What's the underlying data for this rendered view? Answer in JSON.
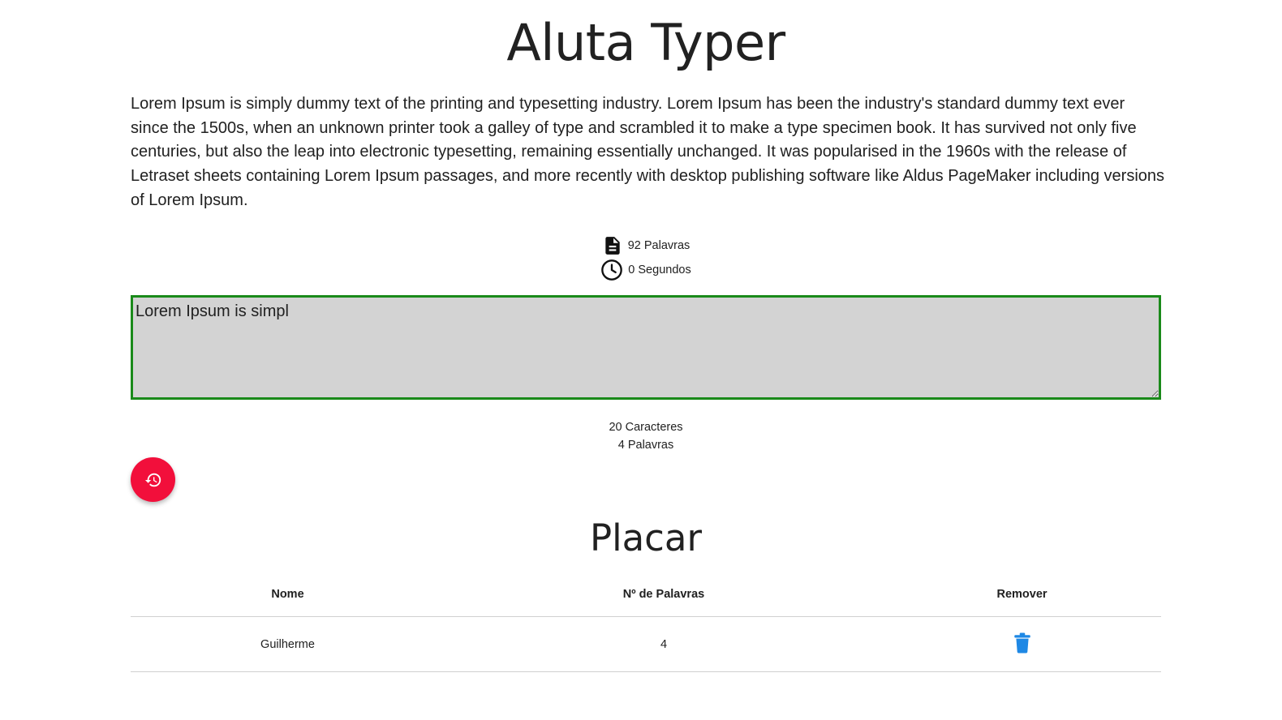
{
  "header": {
    "title": "Aluta Typer"
  },
  "phrase": {
    "text": "Lorem Ipsum is simply dummy text of the printing and typesetting industry. Lorem Ipsum has been the industry's standard dummy text ever since the 1500s, when an unknown printer took a galley of type and scrambled it to make a type specimen book. It has survived not only five centuries, but also the leap into electronic typesetting, remaining essentially unchanged. It was popularised in the 1960s with the release of Letraset sheets containing Lorem Ipsum passages, and more recently with desktop publishing software like Aldus PageMaker including versions of Lorem Ipsum."
  },
  "stats": {
    "words": "92 Palavras",
    "words_icon": "document-icon",
    "time": "0 Segundos",
    "time_icon": "clock-icon"
  },
  "typing": {
    "value": "Lorem Ipsum is simpl",
    "border_color": "#1a8a1a",
    "background": "#d3d3d3"
  },
  "counters": {
    "characters": "20 Caracteres",
    "words": "4 Palavras"
  },
  "restart_button": {
    "icon": "history-icon",
    "color": "#f20f3b"
  },
  "scoreboard": {
    "title": "Placar",
    "headers": {
      "name": "Nome",
      "words": "Nº de Palavras",
      "remove": "Remover"
    },
    "rows": [
      {
        "name": "Guilherme",
        "words": "4",
        "remove_icon": "trash-icon"
      }
    ],
    "remove_icon_color": "#1e88e5"
  }
}
